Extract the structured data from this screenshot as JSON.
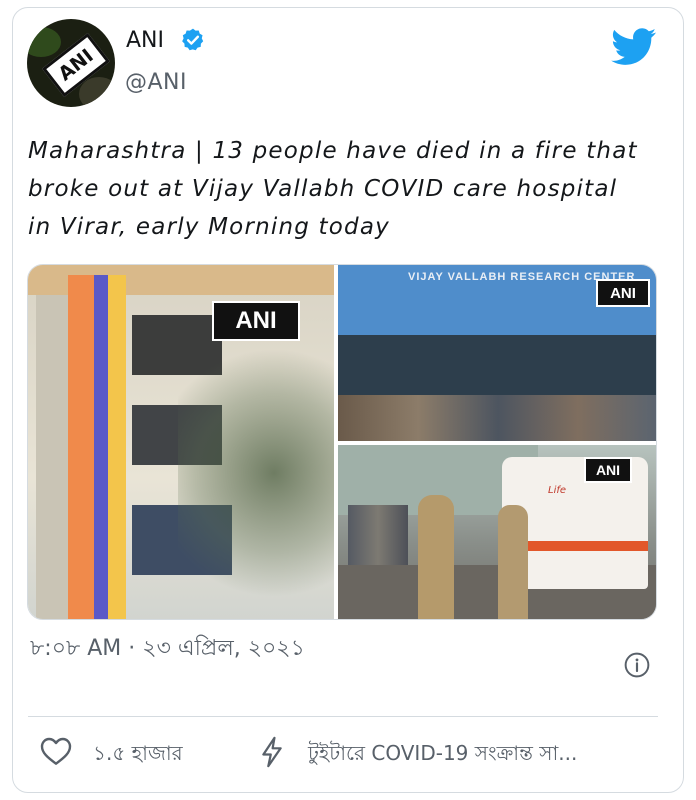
{
  "account": {
    "name": "ANI",
    "handle": "@ANI",
    "avatar_text": "ANI"
  },
  "tweet": {
    "text": "Maharashtra | 13 people have died in a fire that broke out at Vijay Vallabh COVID care hospital in Virar, early Morning today",
    "timestamp": "৮:০৮ AM · ২৩ এপ্রিল, ২০২১"
  },
  "media": {
    "watermark": "ANI",
    "sign_text": "VIJAY VALLABH RESEARCH CENTER",
    "ambulance_text": "Life"
  },
  "actions": {
    "likes": "১.৫ হাজার",
    "related": "টুইটারে COVID-19 সংক্রান্ত সা..."
  },
  "colors": {
    "twitter_blue": "#1da1f2",
    "text": "#14171a",
    "secondary": "#586069",
    "border": "#d5dbe0"
  },
  "icons": [
    "verified-badge-icon",
    "twitter-bird-icon",
    "info-icon",
    "heart-icon",
    "bolt-icon"
  ]
}
